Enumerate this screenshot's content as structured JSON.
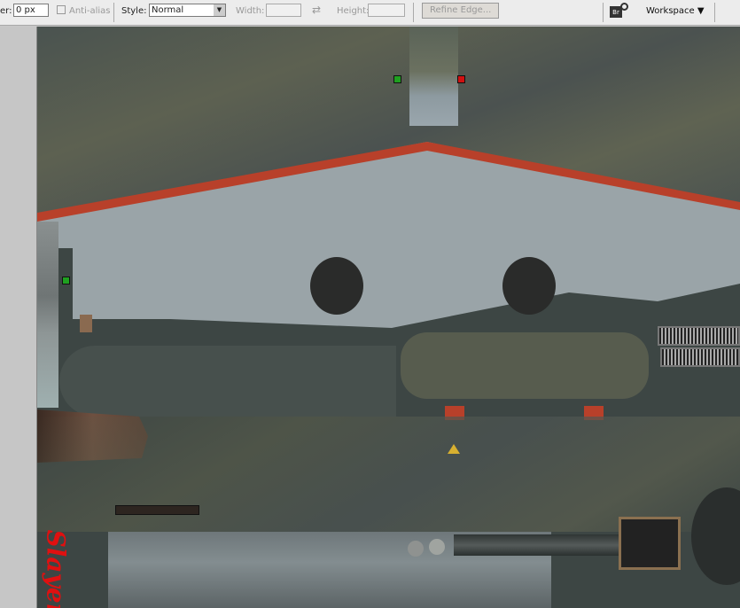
{
  "toolbar": {
    "feather_label": "er:",
    "feather_value": "0 px",
    "antialias_label": "Anti-alias",
    "style_label": "Style:",
    "style_value": "Normal",
    "width_label": "Width:",
    "height_label": "Height:",
    "refine_edge_label": "Refine Edge...",
    "bridge_icon_label": "Br",
    "workspace_label": "Workspace ▼"
  },
  "canvas": {
    "watermark": "Slayer"
  },
  "colors": {
    "canvas_bg": "#3d4644",
    "leading_edge": "#b8402a",
    "underside": "#9aa4a8",
    "camo": "#5a5e4c"
  }
}
